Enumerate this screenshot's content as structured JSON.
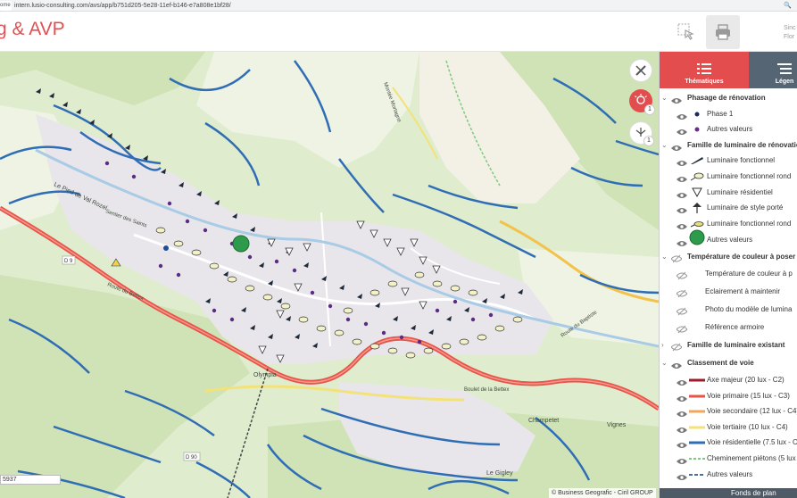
{
  "browser": {
    "tab_stub": "ome",
    "url": "intern.lusio-consulting.com/avs/app/b751d205-5e28-11ef-b146-e7a808e1bf28/",
    "zoom_icon": "magnifier-icon"
  },
  "header": {
    "title": "g & AVP",
    "right_text_line1": "Sinc",
    "right_text_line2": "Flor"
  },
  "map": {
    "coordinates": "5937",
    "attribution": "© Business Geografic - Ciril GROUP",
    "badge1": "1",
    "badge2": "1",
    "labels": {
      "road1": "Le Pied de Val Rozel",
      "road2": "Sentier des Saints",
      "road3": "Route du Bettex",
      "road4": "Route du Baptiste",
      "road5": "Montée Mortagne",
      "road6": "Boulet de la Bettex",
      "place1": "Olympia",
      "place2": "Vignes",
      "place3": "Le Gigley",
      "place4": "Champetet",
      "road_code1": "D 9",
      "road_code2": "D 90"
    }
  },
  "panel": {
    "tabs": {
      "thematic": "Thématiques",
      "legend": "Légen"
    },
    "groups": [
      {
        "label": "Phasage de rénovation",
        "items": [
          {
            "label": "Phase 1",
            "symbol": "dot-navy"
          },
          {
            "label": "Autres valeurs",
            "symbol": "dot-purple"
          }
        ]
      },
      {
        "label": "Famille de luminaire de rénovatio",
        "items": [
          {
            "label": "Luminaire fonctionnel",
            "symbol": "luminaire-functional-icon"
          },
          {
            "label": "Luminaire fonctionnel rond",
            "symbol": "luminaire-round-icon"
          },
          {
            "label": "Luminaire résidentiel",
            "symbol": "luminaire-residential-icon"
          },
          {
            "label": "Luminaire de style porté",
            "symbol": "luminaire-style-icon"
          },
          {
            "label": "Luminaire fonctionnel rond",
            "symbol": "luminaire-round2-icon"
          },
          {
            "label": "Autres valeurs",
            "symbol": "green-circle"
          }
        ]
      },
      {
        "label": "Température de couleur à poser",
        "items": [
          {
            "label": "Température de couleur à p"
          },
          {
            "label": "Eclairement à maintenir"
          },
          {
            "label": "Photo du modèle de lumina"
          },
          {
            "label": "Référence armoire"
          }
        ]
      },
      {
        "label": "Famille de luminaire existant"
      },
      {
        "label": "Classement de voie",
        "items": [
          {
            "label": "Axe majeur (20 lux - C2)",
            "color": "#9b1c2e"
          },
          {
            "label": "Voie primaire (15 lux - C3)",
            "color": "#e8534a"
          },
          {
            "label": "Voie secondaire (12 lux - C4)",
            "color": "#f2a65a"
          },
          {
            "label": "Voie tertiaire (10 lux - C4)",
            "color": "#f3e27a"
          },
          {
            "label": "Voie résidentielle (7.5 lux - C",
            "color": "#2f6db5"
          },
          {
            "label": "Cheminement piétons (5 lux",
            "color": "#7fc97f"
          },
          {
            "label": "Autres valeurs",
            "color": "#4a6fa5"
          }
        ]
      }
    ],
    "bottom": "Fonds de plan"
  },
  "colors": {
    "accent": "#e44d4e",
    "legend_tab": "#556573",
    "map_bg": "#dfeccd"
  }
}
